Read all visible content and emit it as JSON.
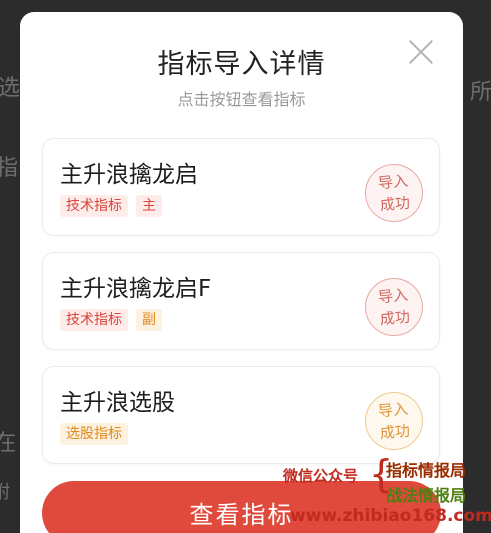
{
  "background": {
    "glyphs": [
      "选",
      "指",
      "在",
      "附"
    ]
  },
  "modal": {
    "title": "指标导入详情",
    "subtitle": "点击按钮查看指标",
    "close_icon": "close-icon"
  },
  "cards": [
    {
      "name": "主升浪擒龙启",
      "tags": [
        "技术指标",
        "主"
      ],
      "status": [
        "导入",
        "成功"
      ]
    },
    {
      "name": "主升浪擒龙启F",
      "tags": [
        "技术指标",
        "副"
      ],
      "status": [
        "导入",
        "成功"
      ]
    },
    {
      "name": "主升浪选股",
      "tags": [
        "选股指标"
      ],
      "status": [
        "导入",
        "成功"
      ]
    }
  ],
  "actions": {
    "view_button": "查看指标"
  },
  "watermark": {
    "label": "微信公众号",
    "line1": "指标情报局",
    "line2": "战法情报局",
    "url": "www.zhibiao168.com"
  },
  "colors": {
    "accent": "#df4a3d",
    "tag_red": "#d9453c",
    "tag_orange": "#e08a1e"
  }
}
